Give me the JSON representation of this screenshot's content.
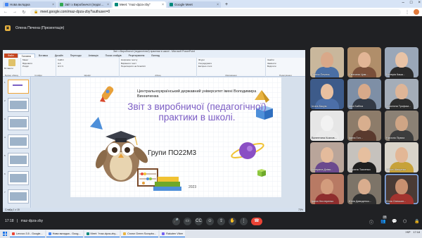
{
  "browser": {
    "tabs": [
      {
        "label": "Нова вкладка",
        "color": "#4285f4",
        "active": false
      },
      {
        "label": "Звіт з Виробничої (педагогічн...",
        "color": "#34a853",
        "active": false
      },
      {
        "label": "Meet: \"maz-dpza-zby\"",
        "color": "#00897b",
        "active": true
      },
      {
        "label": "Google Meet",
        "color": "#00897b",
        "active": false
      }
    ],
    "new_tab": "+",
    "url": "meet.google.com/maz-dpza-zby?authuser=0"
  },
  "meet": {
    "presenter_label": "Олена Печена (Презентація)",
    "meeting_time": "17:18",
    "meeting_code": "maz-dpza-zby",
    "participant_count": "16",
    "participants": [
      {
        "name": "Олена Печена",
        "skin": "#d9a889",
        "shirt": "#4a6fa5",
        "bg": "#c9b79c"
      },
      {
        "name": "Світлана Цим...",
        "skin": "#e2b596",
        "shirt": "#7a4f3a",
        "bg": "#b08e6a"
      },
      {
        "name": "Валерія Кашк...",
        "skin": "#e8c3a6",
        "shirt": "#2b2b2b",
        "bg": "#9aa7b8"
      },
      {
        "name": "Ілона Бакум",
        "skin": "#e9c0a0",
        "shirt": "#4c6fa8",
        "bg": "#3d5b8a"
      },
      {
        "name": "Інна Бабіна",
        "skin": "#d7a98a",
        "shirt": "#333a46",
        "bg": "#7e8fa6"
      },
      {
        "name": "Христина Трофим...",
        "skin": "#deb597",
        "shirt": "#2d2d2d",
        "bg": "#a4adb8"
      },
      {
        "name": "Валентина Козлов...",
        "skin": "#f2f2f2",
        "shirt": "#eaeaea",
        "bg": "#e6e6e6"
      },
      {
        "name": "Ірина Гон...",
        "skin": "#d8ae8e",
        "shirt": "#5a3a2e",
        "bg": "#8d7c6a"
      },
      {
        "name": "Наталія Пірвах",
        "skin": "#cfa585",
        "shirt": "#3d3d3d",
        "bg": "#8b8175"
      },
      {
        "name": "Катерина Дзіва...",
        "skin": "#e4bb9c",
        "shirt": "#6b4a8e",
        "bg": "#b9a59a"
      },
      {
        "name": "Марина Ткаченко",
        "skin": "#e6bf9f",
        "shirt": "#1f1f1f",
        "bg": "#c6c2bd"
      },
      {
        "name": "Ольга Шищенко",
        "skin": "#e3b796",
        "shirt": "#c7a23a",
        "bg": "#d9d4ca"
      },
      {
        "name": "Ірина Нестеренко",
        "skin": "#d39c7d",
        "shirt": "#8f2e2e",
        "bg": "#b87a64"
      },
      {
        "name": "Юлія Давиденко...",
        "skin": "#d9ad8e",
        "shirt": "#2f2f2f",
        "bg": "#7d7468"
      },
      {
        "name": "Юлія Олексан...",
        "skin": "#c89070",
        "shirt": "#a3342f",
        "bg": "#4a3b35"
      }
    ]
  },
  "powerpoint": {
    "window_title": "Звіт з Виробничої (педагогічної) практики в школі - Microsoft PowerPoint",
    "tabs": [
      "Файл",
      "Головна",
      "Вставка",
      "Дизайн",
      "Переходи",
      "Анімація",
      "Показ слайдів",
      "Рецензування",
      "Вигляд"
    ],
    "ribbon_groups": [
      {
        "label": "Буфер обміну",
        "buttons": [
          "Вставити"
        ]
      },
      {
        "label": "Слайди",
        "buttons": [
          "Макет",
          "Відновити",
          "Розділ"
        ]
      },
      {
        "label": "Шрифт",
        "buttons": [
          "Calibri",
          "A A",
          "Ж К Ч"
        ]
      },
      {
        "label": "Абзац",
        "buttons": [
          "Напрямок тексту",
          "Вирівняти текст",
          "Перетворити на SmartArt"
        ]
      },
      {
        "label": "Малювання",
        "buttons": [
          "Фігури",
          "Упорядкувати",
          "Експрес-стилі"
        ]
      },
      {
        "label": "Редагування",
        "buttons": [
          "Знайти",
          "Замінити",
          "Виділити"
        ]
      }
    ],
    "slide_numbers": [
      "1",
      "2",
      "3",
      "4",
      "5",
      "6",
      "7"
    ],
    "status_left": "Слайд 1 з 15",
    "status_right": "73%",
    "slide": {
      "university": "Центральноукраїнський державний університет імені Володимира Винниченка",
      "title": "Звіт з виробничої (педагогічної) практики в школі.",
      "group": "Групи ПО22М3",
      "year": "2023"
    }
  },
  "taskbar": {
    "items": [
      {
        "label": "Lenovo 3.5 - Google...",
        "color": "#ea4335"
      },
      {
        "label": "Нова вкладка - Goog...",
        "color": "#4285f4"
      },
      {
        "label": "Meet: \"maz-dpza-zby...",
        "color": "#00897b"
      },
      {
        "label": "Crown Green Scrapbo...",
        "color": "#e8b340"
      },
      {
        "label": "Rakuten Viber",
        "color": "#7360f2"
      }
    ],
    "lang": "УКР",
    "time": "17:18"
  }
}
